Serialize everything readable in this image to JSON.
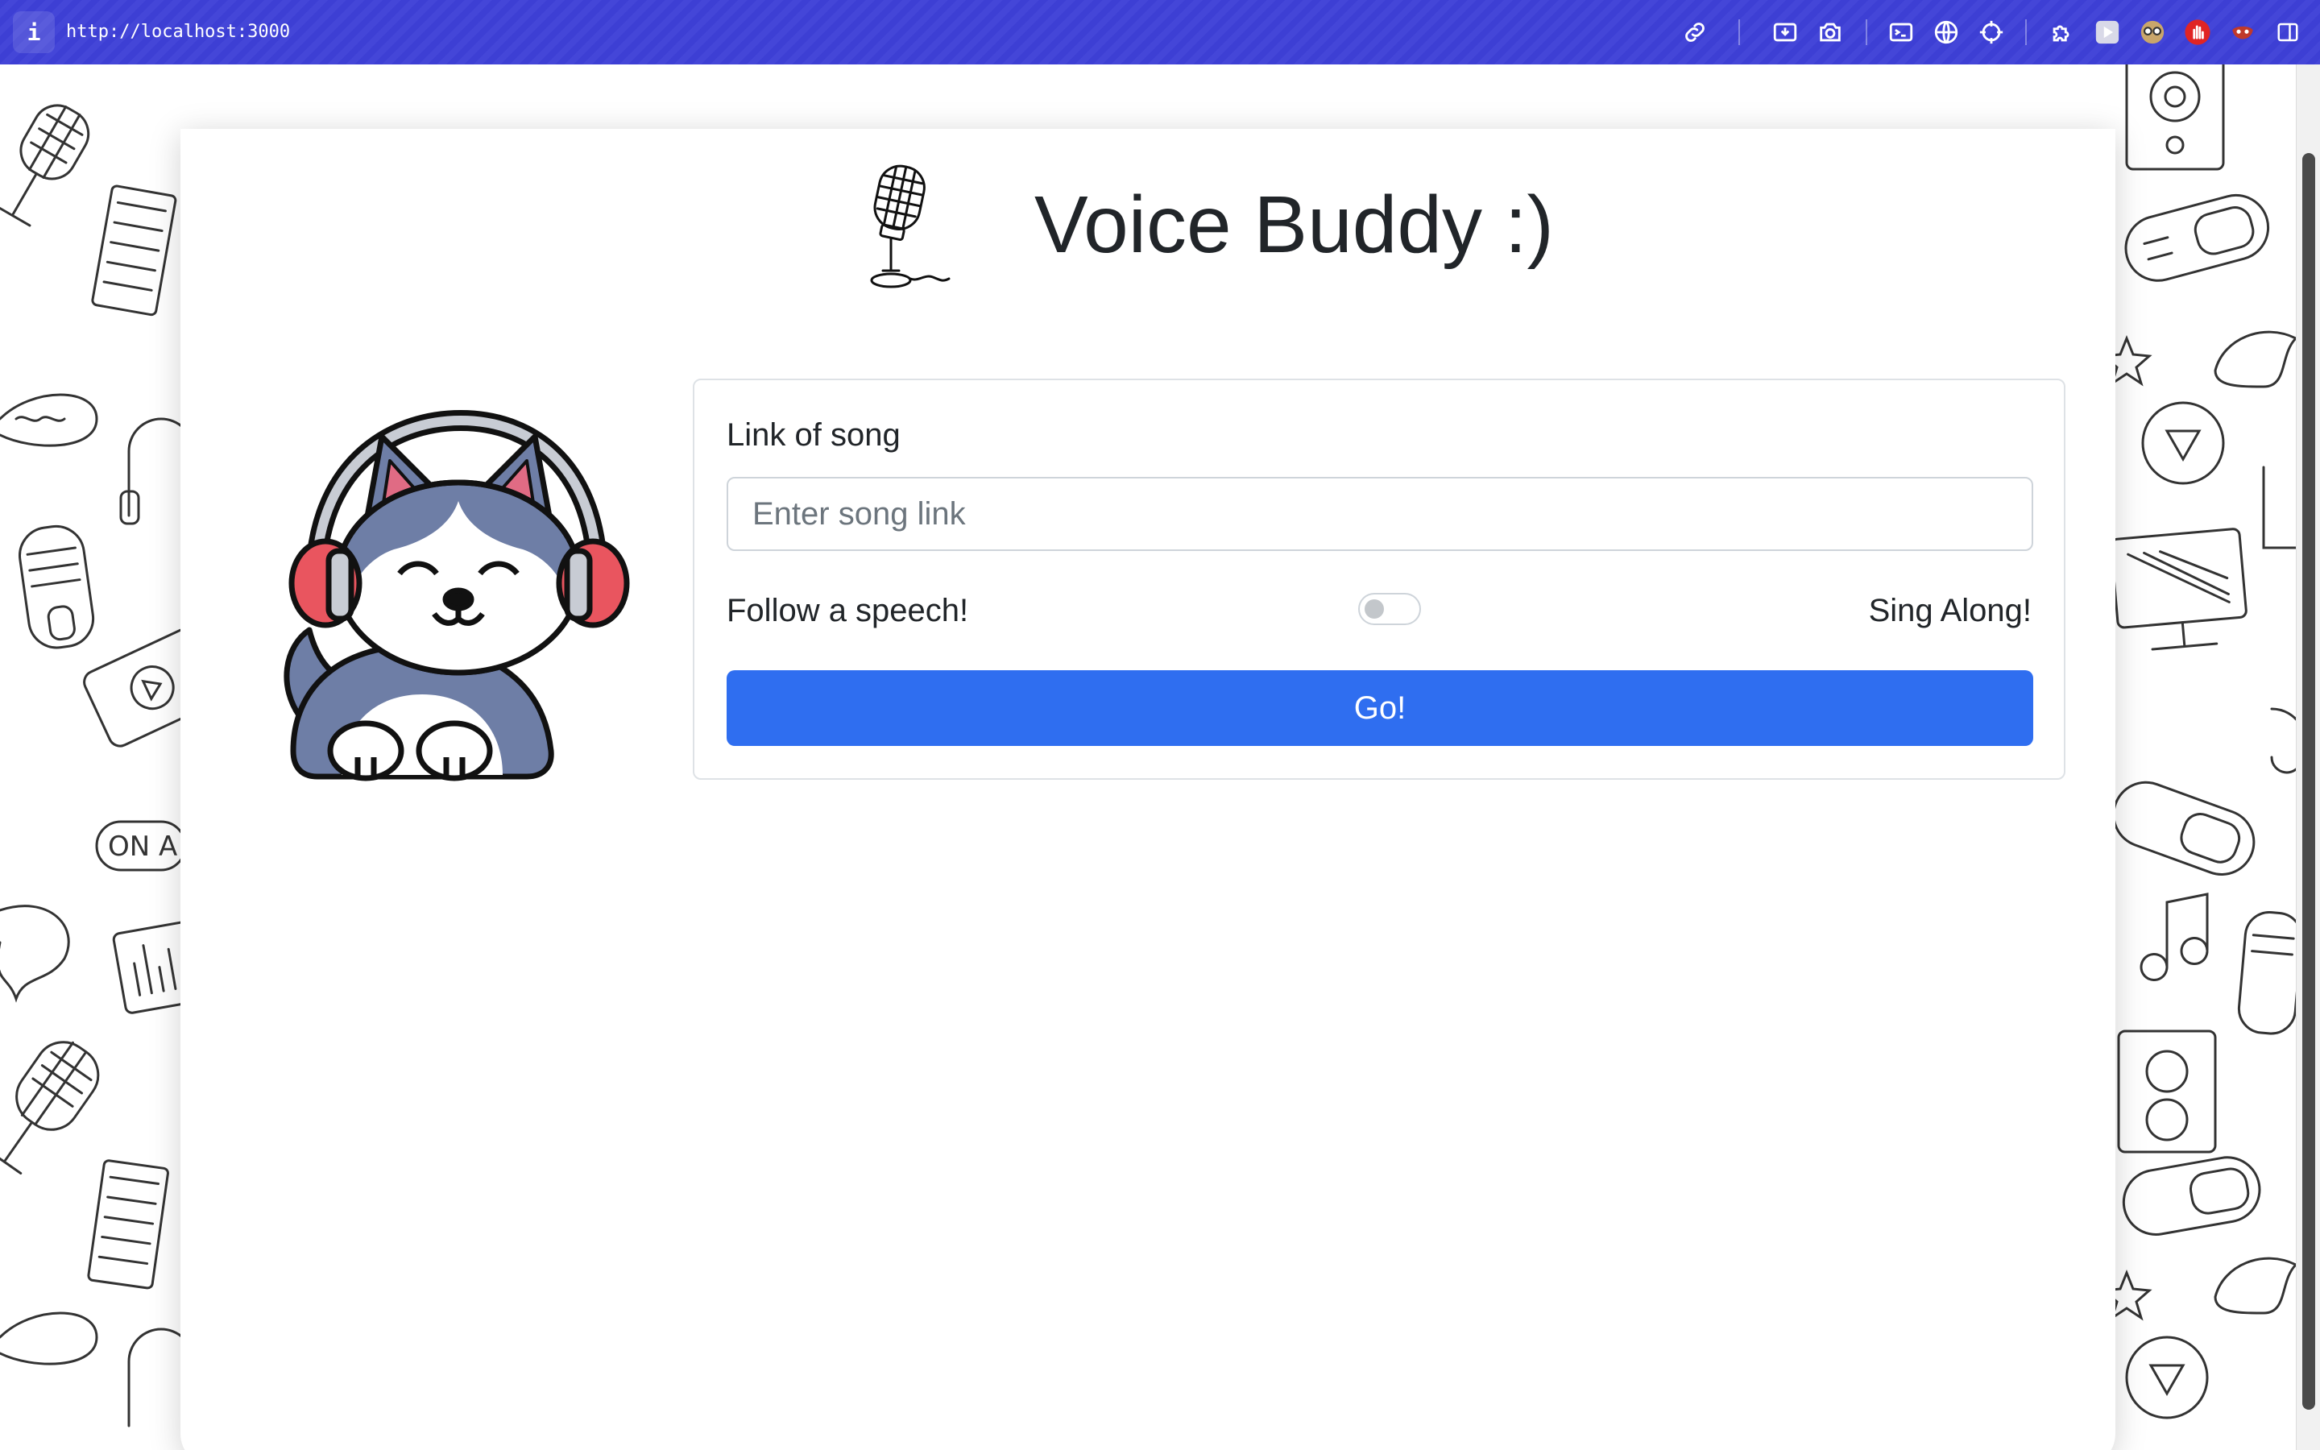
{
  "browser": {
    "info_label": "i",
    "url": "http://localhost:3000",
    "toolbar_icons": [
      "link-icon",
      "screenshot-region-icon",
      "camera-icon",
      "terminal-icon",
      "globe-icon",
      "crosshair-icon",
      "puzzle-extension-icon",
      "play-extension-icon",
      "glasses-extension-icon",
      "hand-extension-icon",
      "mask-extension-icon",
      "sidebar-toggle-icon"
    ],
    "accent_color": "#3d3fd4"
  },
  "page": {
    "title": "Voice Buddy :)",
    "logo_icon": "microphone-icon",
    "mascot_icon": "husky-headphones-mascot",
    "form": {
      "link_label": "Link of song",
      "link_placeholder": "Enter song link",
      "link_value": "",
      "mode_left_label": "Follow a speech!",
      "mode_right_label": "Sing Along!",
      "mode_toggle_on": false,
      "submit_label": "Go!",
      "submit_color": "#2f6ef0"
    }
  }
}
